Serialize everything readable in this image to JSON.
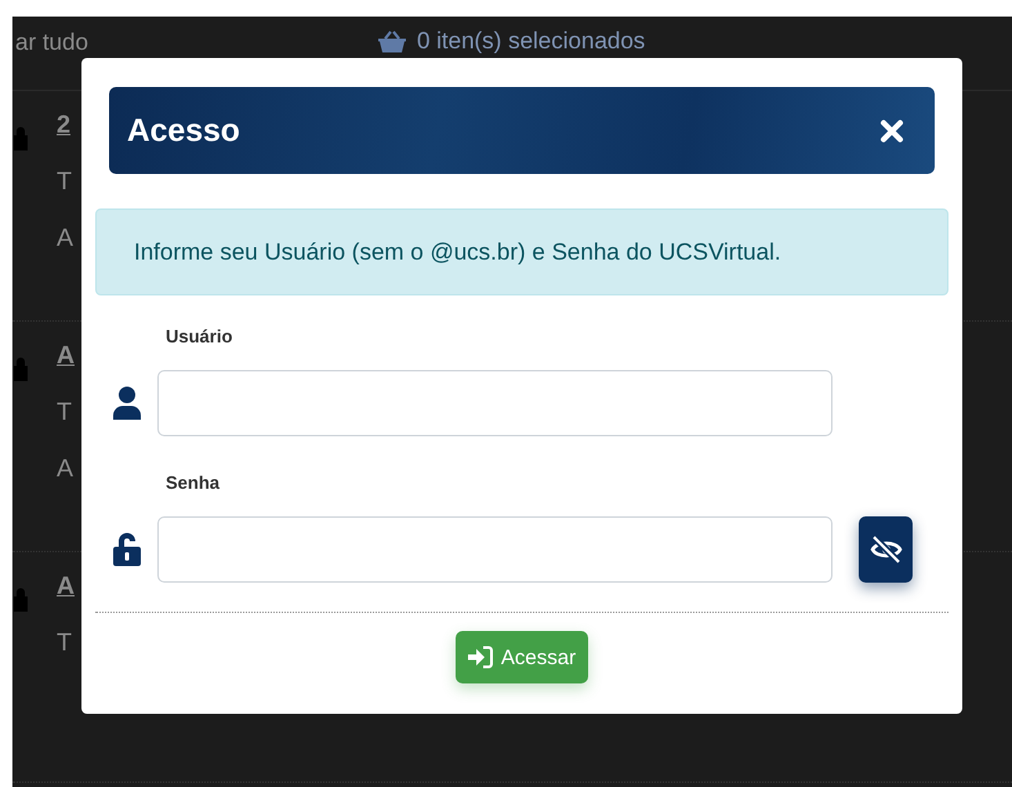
{
  "background": {
    "select_all_fragment": "ar tudo",
    "selection_count": "0 iten(s) selecionados",
    "items": [
      {
        "title": "2",
        "lines": [
          "T",
          "A"
        ]
      },
      {
        "title": "A",
        "lines": [
          "T",
          "A"
        ]
      },
      {
        "title": "A",
        "lines": [
          "T"
        ]
      }
    ]
  },
  "modal": {
    "title": "Acesso",
    "message": "Informe seu Usuário (sem o @ucs.br) e Senha do UCSVirtual.",
    "fields": [
      {
        "kind": "text",
        "label": "Usuário"
      },
      {
        "kind": "password",
        "label": "Senha"
      }
    ],
    "submit": "Acessar"
  }
}
